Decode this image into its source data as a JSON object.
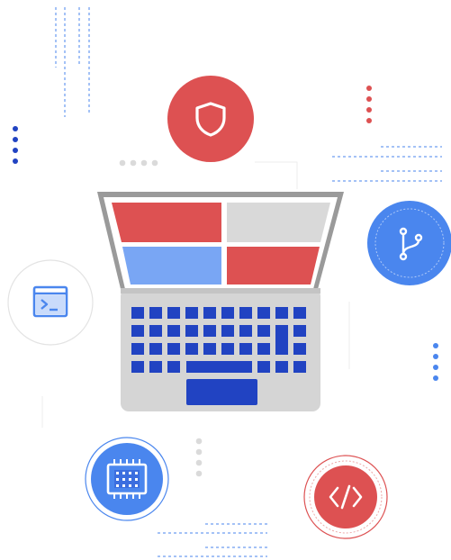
{
  "illustration": {
    "subject": "laptop-with-devops-icons",
    "colors": {
      "red": "#dd5152",
      "blue": "#4a86ee",
      "navy": "#2143c2",
      "light_blue": "#79a6f4",
      "screen_gray": "#d9d9d9",
      "frame_gray": "#9a9a9a",
      "body_gray": "#d5d5d5",
      "dot_gray": "#dadada",
      "outline_gray": "#e3e3e3"
    },
    "badges": [
      {
        "name": "shield-badge",
        "icon": "shield-icon",
        "color": "red"
      },
      {
        "name": "git-branch-badge",
        "icon": "git-branch-icon",
        "color": "blue"
      },
      {
        "name": "terminal-badge",
        "icon": "terminal-icon",
        "color": "white-outline"
      },
      {
        "name": "chip-badge",
        "icon": "chip-icon",
        "color": "blue"
      },
      {
        "name": "code-badge",
        "icon": "code-brackets-icon",
        "color": "red"
      }
    ],
    "keyboard": {
      "rows": 4,
      "keys_per_row": 10
    }
  }
}
